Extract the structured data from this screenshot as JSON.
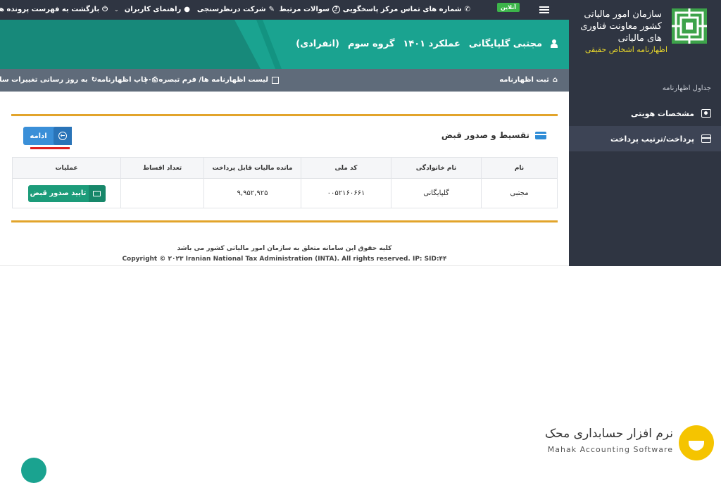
{
  "sidebar": {
    "org_name": "سازمان امور مالیاتی کشور معاونت فناوری های مالیاتی",
    "org_sub": "اظهارنامه اشخاص حقیقی",
    "section_label": "جداول اظهارنامه",
    "items": [
      {
        "label": "مشخصات هویتی",
        "icon": "id-card-icon"
      },
      {
        "label": "پرداخت/ترتیب پرداخت",
        "icon": "credit-card-icon"
      }
    ]
  },
  "topbar": {
    "online": "آنلاین",
    "call_center": "شماره های تماس مرکز پاسخگویی",
    "faq": "سوالات مرتبط",
    "survey": "شرکت درنظرسنجی",
    "user_guide": "راهنمای کاربران",
    "back": "بازگشت به فهرست پرونده ها"
  },
  "header": {
    "name": "مجتبی گلپایگانی",
    "performance": "عملکرد ۱۴۰۱",
    "group": "گروه سوم",
    "type": "(انفرادی)"
  },
  "subbar": {
    "register": "ثبت اظهارنامه",
    "list": "لیست اظهارنامه ها/ فرم تبصره ۱۰۰",
    "print": "چاپ اظهارنامه",
    "update": "به روز رسانی تغییرات سامانه"
  },
  "panel": {
    "title": "تقسیط و صدور قبض",
    "continue": "ادامه",
    "columns": [
      "نام",
      "نام خانوادگی",
      "کد ملی",
      "مانده مالیات قابل پرداخت",
      "تعداد اقساط",
      "عملیات"
    ],
    "row": {
      "first_name": "مجتبی",
      "last_name": "گلپایگانی",
      "national_code": "۰۰۵۲۱۶۰۶۶۱",
      "remaining_tax": "۹,۹۵۲,۹۲۵",
      "installments": "",
      "action": "تایید صدور قبض"
    }
  },
  "footer": {
    "rights_fa": "کلیه حقوق این سامانه متعلق به سازمان امور مالیاتی کشور می باشد",
    "rights_en": "Copyright © ۲۰۲۳ Iranian National Tax Administration (INTA). All rights reserved. IP: SID:۴۴"
  },
  "watermark": {
    "fa": "نرم افزار حسابداری محک",
    "en": "Mahak Accounting Software"
  },
  "colors": {
    "header_teal": "#1aa390",
    "sidebar_dark": "#2f3542",
    "accent_orange": "#e2a42b",
    "button_blue": "#3a8fd8",
    "button_green": "#1c9c7a"
  }
}
